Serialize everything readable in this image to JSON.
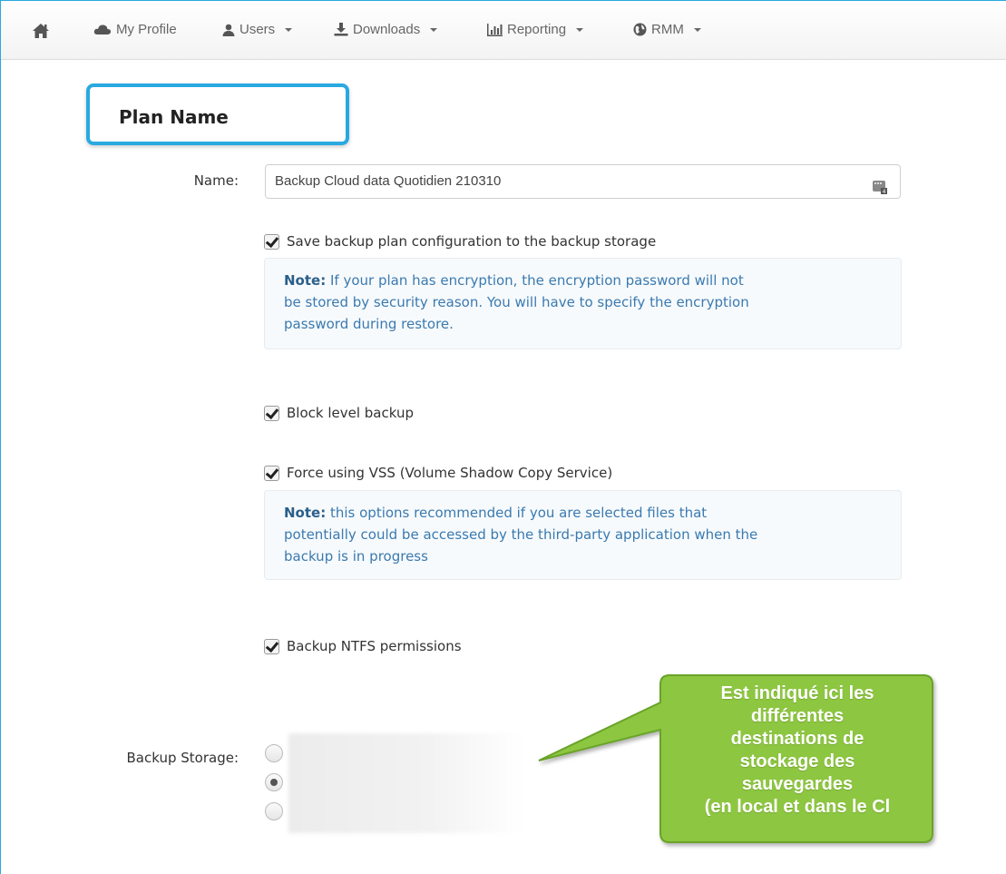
{
  "nav": {
    "items": [
      {
        "label": "My Profile",
        "has_caret": false,
        "icon": "cloud-icon"
      },
      {
        "label": "Users",
        "has_caret": true,
        "icon": "user-icon"
      },
      {
        "label": "Downloads",
        "has_caret": true,
        "icon": "download-icon"
      },
      {
        "label": "Reporting",
        "has_caret": true,
        "icon": "bar-chart-icon"
      },
      {
        "label": "RMM",
        "has_caret": true,
        "icon": "globe-icon"
      }
    ],
    "home_icon": "home-icon"
  },
  "section": {
    "title": "Plan Name"
  },
  "name_field": {
    "label": "Name:",
    "value": "Backup Cloud data Quotidien 210310"
  },
  "options": {
    "save_config": {
      "label": "Save backup plan configuration to the backup storage",
      "checked": true
    },
    "save_note": {
      "prefix": "Note:",
      "lines": [
        "If your plan has encryption, the encryption password will not",
        "be stored by security reason. You will have to specify the encryption",
        "password during restore."
      ]
    },
    "block_level": {
      "label": "Block level backup",
      "checked": true
    },
    "force_vss": {
      "label": "Force using VSS (Volume Shadow Copy Service)",
      "checked": true
    },
    "vss_note": {
      "prefix": "Note:",
      "lines": [
        "this options recommended if you are selected files that",
        "potentially could be accessed by the third-party application when the",
        "backup is in progress"
      ]
    },
    "ntfs": {
      "label": "Backup NTFS permissions",
      "checked": true
    }
  },
  "storage": {
    "label": "Backup Storage:",
    "selected_index": 1
  },
  "callout": {
    "lines": [
      "Est indiqué ici les",
      "différentes",
      "destinations de",
      "stockage des",
      "sauvegardes",
      "(en local et dans le Cl"
    ],
    "fill_color": "#8dc63f",
    "border_color": "#6aa329"
  },
  "colors": {
    "accent": "#29a9e0",
    "note_text": "#3a7ab0"
  }
}
